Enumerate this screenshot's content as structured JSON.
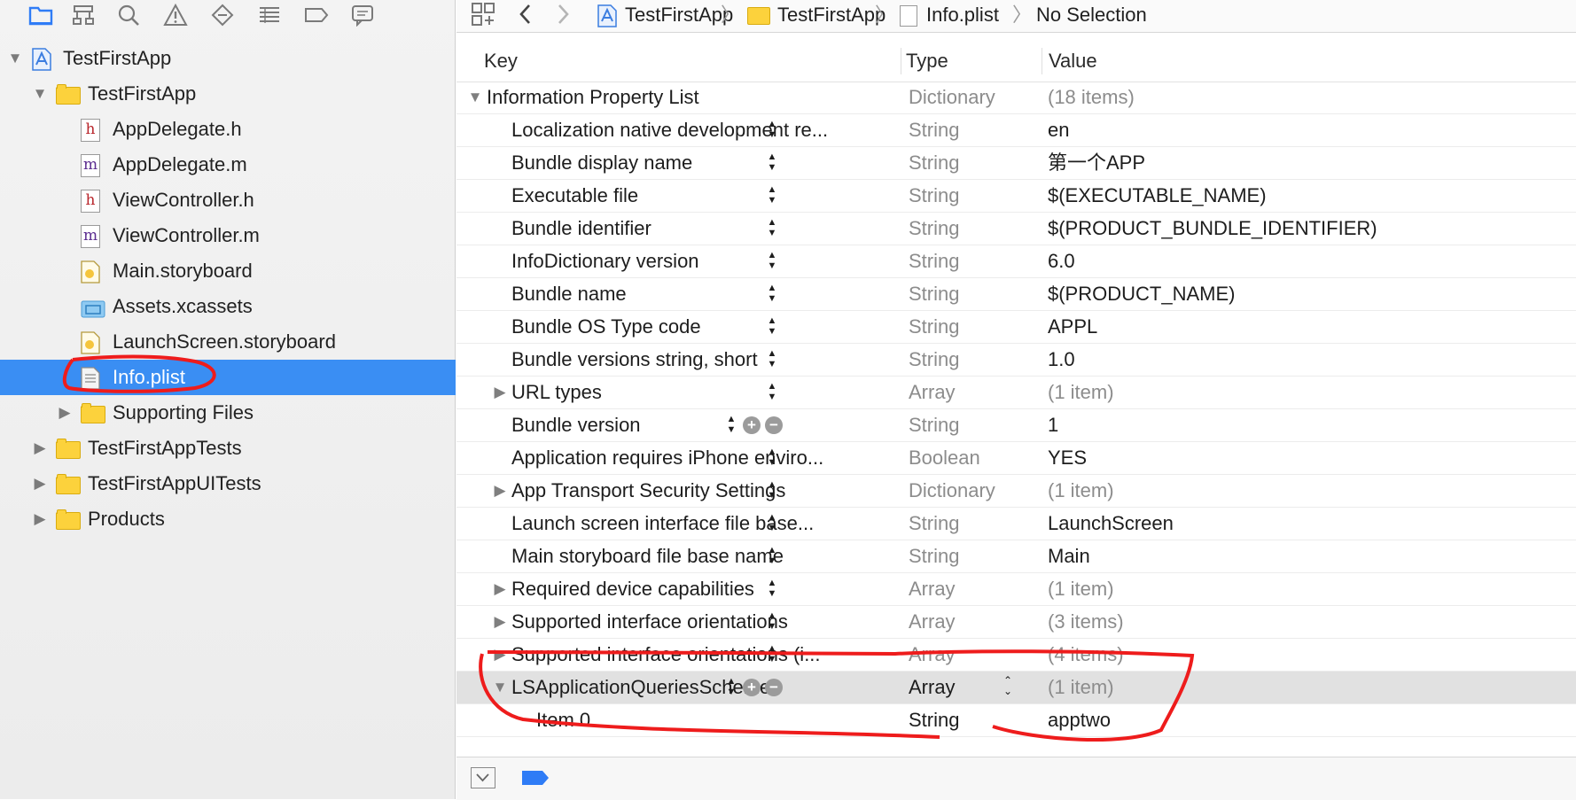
{
  "navigator": {
    "toolbar_icons": [
      "folder-icon",
      "hierarchy-icon",
      "search-icon",
      "warning-icon",
      "breakpoint-icon",
      "list-icon",
      "tag-icon",
      "comment-icon"
    ],
    "items": [
      {
        "label": "TestFirstApp",
        "indent": 0,
        "kind": "project",
        "disclosure": "open"
      },
      {
        "label": "TestFirstApp",
        "indent": 1,
        "kind": "folder",
        "disclosure": "open"
      },
      {
        "label": "AppDelegate.h",
        "indent": 2,
        "kind": "h",
        "disclosure": ""
      },
      {
        "label": "AppDelegate.m",
        "indent": 2,
        "kind": "m",
        "disclosure": ""
      },
      {
        "label": "ViewController.h",
        "indent": 2,
        "kind": "h",
        "disclosure": ""
      },
      {
        "label": "ViewController.m",
        "indent": 2,
        "kind": "m",
        "disclosure": ""
      },
      {
        "label": "Main.storyboard",
        "indent": 2,
        "kind": "storyboard",
        "disclosure": ""
      },
      {
        "label": "Assets.xcassets",
        "indent": 2,
        "kind": "assets",
        "disclosure": ""
      },
      {
        "label": "LaunchScreen.storyboard",
        "indent": 2,
        "kind": "storyboard",
        "disclosure": ""
      },
      {
        "label": "Info.plist",
        "indent": 2,
        "kind": "plist",
        "disclosure": "",
        "selected": true
      },
      {
        "label": "Supporting Files",
        "indent": 2,
        "kind": "folder",
        "disclosure": "closed"
      },
      {
        "label": "TestFirstAppTests",
        "indent": 1,
        "kind": "folder",
        "disclosure": "closed"
      },
      {
        "label": "TestFirstAppUITests",
        "indent": 1,
        "kind": "folder",
        "disclosure": "closed"
      },
      {
        "label": "Products",
        "indent": 1,
        "kind": "folder",
        "disclosure": "closed"
      }
    ]
  },
  "jumpbar": {
    "crumbs": [
      "TestFirstApp",
      "TestFirstApp",
      "Info.plist",
      "No Selection"
    ]
  },
  "columns": {
    "key": "Key",
    "type": "Type",
    "value": "Value"
  },
  "plist_rows": [
    {
      "key": "Information Property List",
      "type": "Dictionary",
      "value": "(18 items)",
      "level": 0,
      "disclosure": "open",
      "muted": true
    },
    {
      "key": "Localization native development re...",
      "type": "String",
      "value": "en",
      "level": 1,
      "disclosure": ""
    },
    {
      "key": "Bundle display name",
      "type": "String",
      "value": "第一个APP",
      "level": 1,
      "disclosure": ""
    },
    {
      "key": "Executable file",
      "type": "String",
      "value": "$(EXECUTABLE_NAME)",
      "level": 1,
      "disclosure": ""
    },
    {
      "key": "Bundle identifier",
      "type": "String",
      "value": "$(PRODUCT_BUNDLE_IDENTIFIER)",
      "level": 1,
      "disclosure": ""
    },
    {
      "key": "InfoDictionary version",
      "type": "String",
      "value": "6.0",
      "level": 1,
      "disclosure": ""
    },
    {
      "key": "Bundle name",
      "type": "String",
      "value": "$(PRODUCT_NAME)",
      "level": 1,
      "disclosure": ""
    },
    {
      "key": "Bundle OS Type code",
      "type": "String",
      "value": "APPL",
      "level": 1,
      "disclosure": ""
    },
    {
      "key": "Bundle versions string, short",
      "type": "String",
      "value": "1.0",
      "level": 1,
      "disclosure": ""
    },
    {
      "key": "URL types",
      "type": "Array",
      "value": "(1 item)",
      "level": 1,
      "disclosure": "closed",
      "muted": true
    },
    {
      "key": "Bundle version",
      "type": "String",
      "value": "1",
      "level": 1,
      "disclosure": "",
      "buttons": true
    },
    {
      "key": "Application requires iPhone enviro...",
      "type": "Boolean",
      "value": "YES",
      "level": 1,
      "disclosure": ""
    },
    {
      "key": "App Transport Security Settings",
      "type": "Dictionary",
      "value": "(1 item)",
      "level": 1,
      "disclosure": "closed",
      "muted": true
    },
    {
      "key": "Launch screen interface file base...",
      "type": "String",
      "value": "LaunchScreen",
      "level": 1,
      "disclosure": ""
    },
    {
      "key": "Main storyboard file base name",
      "type": "String",
      "value": "Main",
      "level": 1,
      "disclosure": ""
    },
    {
      "key": "Required device capabilities",
      "type": "Array",
      "value": "(1 item)",
      "level": 1,
      "disclosure": "closed",
      "muted": true
    },
    {
      "key": "Supported interface orientations",
      "type": "Array",
      "value": "(3 items)",
      "level": 1,
      "disclosure": "closed",
      "muted": true
    },
    {
      "key": "Supported interface orientations (i...",
      "type": "Array",
      "value": "(4 items)",
      "level": 1,
      "disclosure": "closed",
      "muted": true
    },
    {
      "key": "LSApplicationQueriesSchemes",
      "type": "Array",
      "value": "(1 item)",
      "level": 1,
      "disclosure": "open",
      "muted": true,
      "buttons": true,
      "highlight": true,
      "typeDark": true
    },
    {
      "key": "Item 0",
      "type": "String",
      "value": "apptwo",
      "level": 2,
      "disclosure": "",
      "typeDark": true
    }
  ],
  "colors": {
    "selection": "#3a8ef3",
    "annotation": "#ee1c1c",
    "folder": "#fcd23c",
    "accent": "#2f7cf6"
  }
}
